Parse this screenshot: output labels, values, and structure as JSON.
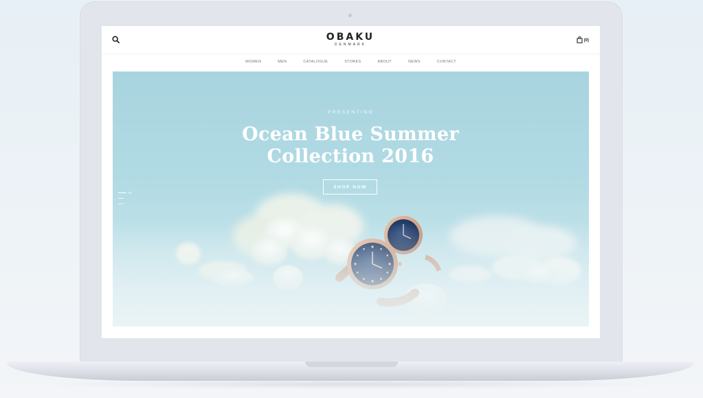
{
  "header": {
    "logo_main": "OBAKU",
    "logo_sub": "DENMARK",
    "cart_count": "(0)",
    "icons": [
      "search-icon",
      "bag-icon"
    ]
  },
  "nav": {
    "items": [
      "WOMEN",
      "MEN",
      "CATALOGUE",
      "STORES",
      "ABOUT",
      "NEWS",
      "CONTACT"
    ]
  },
  "hero": {
    "eyebrow": "PRESENTING",
    "title_line1": "Ocean Blue Summer",
    "title_line2": "Collection 2016",
    "cta": "SHOP NOW",
    "slide_indicator": "01"
  },
  "colors": {
    "hero_sky": "#a8d4df",
    "watch_face": "#1f3a6b",
    "watch_case": "#d4a38a",
    "device": "#e3e5ec"
  }
}
